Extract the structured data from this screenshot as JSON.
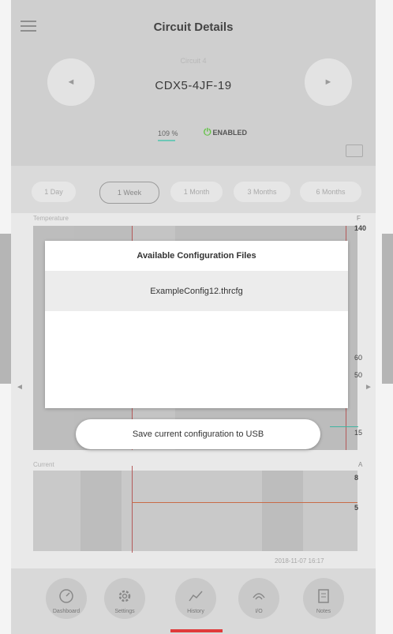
{
  "header": {
    "title": "Circuit Details",
    "subtitle": "Circuit 4",
    "circuit_name": "CDX5-4JF-19",
    "percent": "109 %",
    "status": "ENABLED"
  },
  "nav": {
    "prev_arrow": "◄",
    "next_arrow": "►"
  },
  "ranges": [
    "1 Day",
    "1 Week",
    "1 Month",
    "3 Months",
    "6 Months"
  ],
  "active_range": "1 Week",
  "chart1": {
    "label": "Temperature",
    "unit": "F",
    "ticks": [
      "140",
      "60",
      "50",
      "15"
    ]
  },
  "chart2": {
    "label": "Current",
    "unit": "A",
    "ticks": [
      "8",
      "5"
    ]
  },
  "timestamp": "2018-11-07 16:17",
  "dialog": {
    "title": "Available Configuration Files",
    "files": [
      "ExampleConfig12.thrcfg"
    ]
  },
  "save_button": "Save current configuration to USB",
  "bottom_nav": [
    {
      "label": "Dashboard",
      "icon": "gauge-icon"
    },
    {
      "label": "Settings",
      "icon": "gear-icon"
    },
    {
      "label": "History",
      "icon": "trend-chart-icon"
    },
    {
      "label": "I/O",
      "icon": "signal-icon"
    },
    {
      "label": "Notes",
      "icon": "notes-icon"
    }
  ],
  "active_nav": "History",
  "colors": {
    "accent_red": "#e03a3a",
    "power_green": "#66c34a",
    "trend_teal": "#3fb4a2"
  }
}
